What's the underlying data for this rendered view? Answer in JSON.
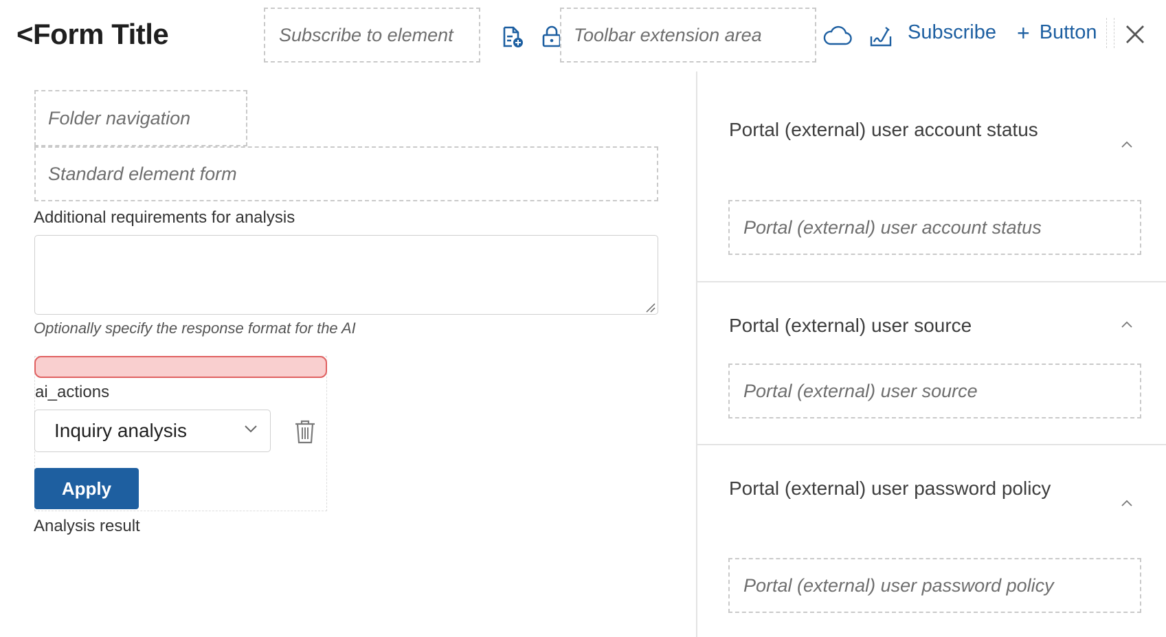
{
  "header": {
    "title": "<Form Title",
    "subscribe_element_placeholder": "Subscribe to element",
    "toolbar_extension_placeholder": "Toolbar extension area",
    "subscribe_label": "Subscribe",
    "button_label": "Button",
    "icons": [
      "document-share-icon",
      "lock-icon",
      "cloud-icon",
      "signature-icon",
      "plus-icon",
      "close-icon"
    ]
  },
  "left": {
    "folder_navigation": "Folder navigation",
    "standard_element_form": "Standard element form",
    "requirements_label": "Additional requirements for analysis",
    "requirements_value": "",
    "requirements_hint": "Optionally specify the response format for the AI",
    "ai_actions_label": "ai_actions",
    "ai_action_selected": "Inquiry analysis",
    "apply_label": "Apply",
    "analysis_result_label": "Analysis result"
  },
  "right": {
    "sections": [
      {
        "title": "Portal (external) user account status",
        "placeholder": "Portal (external) user account status",
        "expanded": true
      },
      {
        "title": "Portal (external) user source",
        "placeholder": "Portal (external) user source",
        "expanded": true
      },
      {
        "title": "Portal (external) user password policy",
        "placeholder": "Portal (external) user password policy",
        "expanded": true
      }
    ]
  },
  "colors": {
    "accent": "#1e5fa0",
    "link": "#1d5fa1",
    "error_fill": "#f9cfcf",
    "error_border": "#e06060",
    "placeholder_border": "#c9c9c9"
  }
}
